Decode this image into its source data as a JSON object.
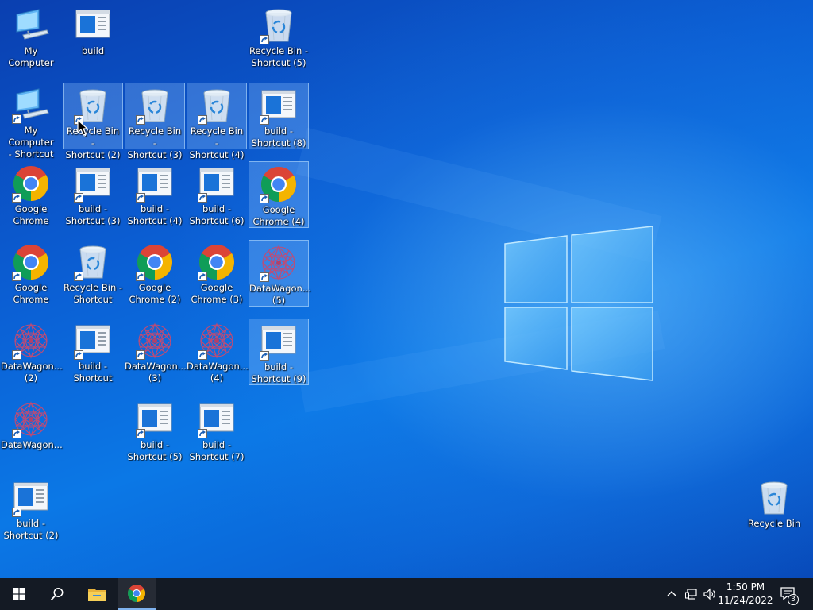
{
  "icons": [
    {
      "label": "My Computer",
      "type": "computer",
      "shortcut": false,
      "selected": false
    },
    {
      "label": "build",
      "type": "build",
      "shortcut": false,
      "selected": false
    },
    {
      "label": "Recycle Bin -\nShortcut (5)",
      "type": "recycle",
      "shortcut": true,
      "selected": false
    },
    {
      "label": "My Computer\n- Shortcut",
      "type": "computer",
      "shortcut": true,
      "selected": false
    },
    {
      "label": "Recycle Bin -\nShortcut (2)",
      "type": "recycle",
      "shortcut": true,
      "selected": true
    },
    {
      "label": "Recycle Bin -\nShortcut (3)",
      "type": "recycle",
      "shortcut": true,
      "selected": true
    },
    {
      "label": "Recycle Bin -\nShortcut (4)",
      "type": "recycle",
      "shortcut": true,
      "selected": true
    },
    {
      "label": "build -\nShortcut (8)",
      "type": "build",
      "shortcut": true,
      "selected": true
    },
    {
      "label": "Google\nChrome",
      "type": "chrome",
      "shortcut": true,
      "selected": false
    },
    {
      "label": "build -\nShortcut (3)",
      "type": "build",
      "shortcut": true,
      "selected": false
    },
    {
      "label": "build -\nShortcut (4)",
      "type": "build",
      "shortcut": true,
      "selected": false
    },
    {
      "label": "build -\nShortcut (6)",
      "type": "build",
      "shortcut": true,
      "selected": false
    },
    {
      "label": "Google\nChrome (4)",
      "type": "chrome",
      "shortcut": true,
      "selected": true
    },
    {
      "label": "Google\nChrome",
      "type": "chrome",
      "shortcut": true,
      "selected": false
    },
    {
      "label": "Recycle Bin -\nShortcut",
      "type": "recycle",
      "shortcut": true,
      "selected": false
    },
    {
      "label": "Google\nChrome (2)",
      "type": "chrome",
      "shortcut": true,
      "selected": false
    },
    {
      "label": "Google\nChrome (3)",
      "type": "chrome",
      "shortcut": true,
      "selected": false
    },
    {
      "label": "DataWagon...\n(5)",
      "type": "datawagon",
      "shortcut": true,
      "selected": true
    },
    {
      "label": "DataWagon...\n(2)",
      "type": "datawagon",
      "shortcut": true,
      "selected": false
    },
    {
      "label": "build -\nShortcut",
      "type": "build",
      "shortcut": true,
      "selected": false
    },
    {
      "label": "DataWagon...\n(3)",
      "type": "datawagon",
      "shortcut": true,
      "selected": false
    },
    {
      "label": "DataWagon...\n(4)",
      "type": "datawagon",
      "shortcut": true,
      "selected": false
    },
    {
      "label": "build -\nShortcut (9)",
      "type": "build",
      "shortcut": true,
      "selected": true
    },
    {
      "label": "DataWagon...",
      "type": "datawagon",
      "shortcut": true,
      "selected": false
    },
    {
      "label": "build -\nShortcut (5)",
      "type": "build",
      "shortcut": true,
      "selected": false
    },
    {
      "label": "build -\nShortcut (7)",
      "type": "build",
      "shortcut": true,
      "selected": false
    },
    {
      "label": "build -\nShortcut (2)",
      "type": "build",
      "shortcut": true,
      "selected": false
    },
    {
      "label": "Recycle Bin",
      "type": "recycle",
      "shortcut": false,
      "selected": false
    }
  ],
  "taskbar": {
    "start_icon": "windows-logo-icon",
    "search_icon": "search-icon",
    "pinned": [
      {
        "name": "file-explorer-icon"
      },
      {
        "name": "chrome-icon",
        "active": true
      }
    ],
    "tray": {
      "icons": [
        "chevron-up-icon",
        "network-icon",
        "volume-icon"
      ],
      "time": "1:50 PM",
      "date": "11/24/2022",
      "notification_count": "3"
    }
  },
  "colors": {
    "desktop_blue": "#0b6cdc",
    "taskbar": "#141a24",
    "selection": "#96c8ff"
  }
}
